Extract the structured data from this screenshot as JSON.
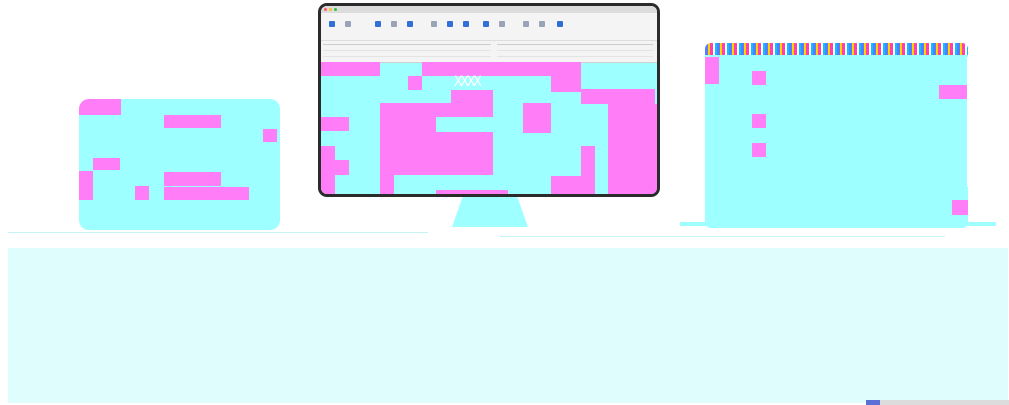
{
  "colors": {
    "cyan": "#9dffff",
    "magenta": "#ff7df6",
    "accent": "#2f6fd6",
    "traffic_red": "#ff5f57",
    "traffic_yellow": "#febc2e",
    "traffic_green": "#28c840"
  },
  "monitor": {
    "window_title": "",
    "menu_items": [
      "",
      "",
      "",
      "",
      "",
      "",
      ""
    ],
    "ribbon_buttons": [
      {
        "icon": "cube-icon"
      },
      {
        "icon": "filter-icon"
      },
      {
        "icon": "grid-icon"
      },
      {
        "icon": "table-icon"
      },
      {
        "icon": "grid-icon"
      },
      {
        "icon": "copy-icon"
      },
      {
        "icon": "chart-icon"
      },
      {
        "icon": "chart-icon"
      },
      {
        "icon": "export-icon"
      },
      {
        "icon": "export-icon"
      },
      {
        "icon": "settings-icon"
      },
      {
        "icon": "settings-icon"
      },
      {
        "icon": "wrench-icon"
      }
    ],
    "glyph_text": "XXXX"
  }
}
